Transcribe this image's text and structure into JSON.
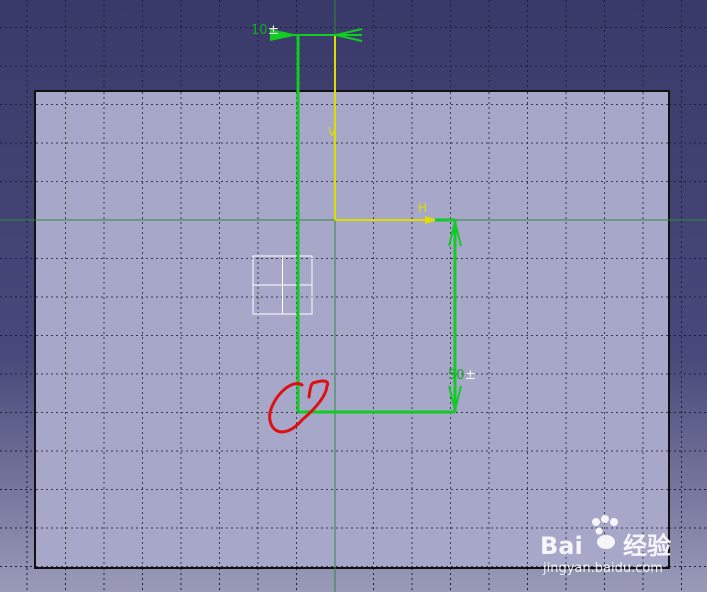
{
  "viewport": {
    "background_top": "#3c3c6c",
    "background_bottom": "#8c8cac",
    "sheet_fill": "#a7a7c9",
    "grid_color": "#404050",
    "geometry_color": "#11cc22",
    "construction_color": "#dddd00",
    "annotation_color": "#dd1111"
  },
  "dimensions": {
    "top_width": "10",
    "right_height": "50"
  },
  "tolerance_symbol": "±",
  "axes": {
    "h_label": "H",
    "v_label": "V"
  },
  "watermark": {
    "logo_text": "Bai",
    "logo_suffix": "经验",
    "url": "jingyan.baidu.com"
  }
}
